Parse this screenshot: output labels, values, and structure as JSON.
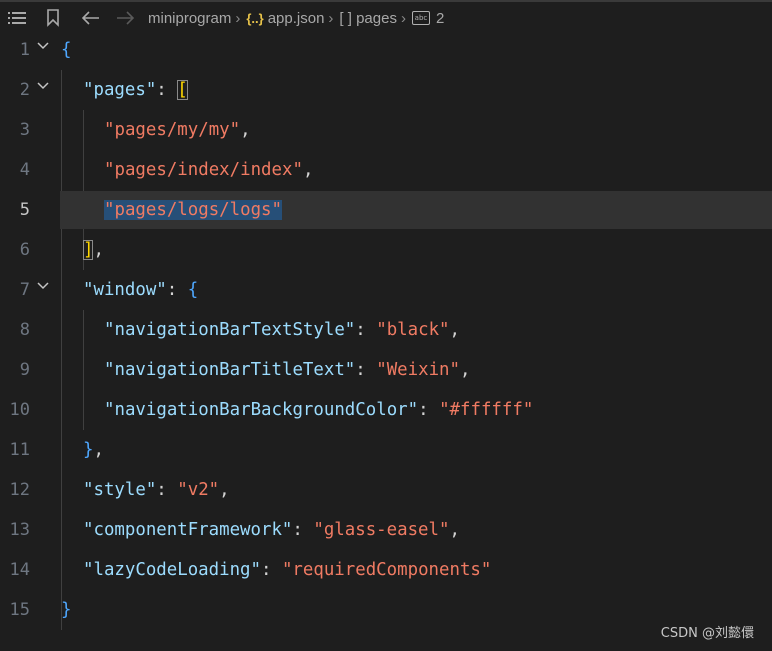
{
  "breadcrumb": {
    "items": [
      "miniprogram",
      "app.json",
      "[ ] pages",
      "2"
    ],
    "icons": [
      "list-icon",
      "bookmark-icon",
      "back-arrow-icon",
      "forward-arrow-icon"
    ]
  },
  "editor": {
    "current_line": 5,
    "line_numbers": [
      "1",
      "2",
      "3",
      "4",
      "5",
      "6",
      "7",
      "8",
      "9",
      "10",
      "11",
      "12",
      "13",
      "14",
      "15"
    ]
  },
  "code": {
    "l1_brace": "{",
    "l2_key": "\"pages\"",
    "l2_colon": ": ",
    "l2_bracket": "[",
    "l3_val": "\"pages/my/my\"",
    "l3_comma": ",",
    "l4_val": "\"pages/index/index\"",
    "l4_comma": ",",
    "l5_val": "\"pages/logs/logs\"",
    "l6_bracket": "]",
    "l6_comma": ",",
    "l7_key": "\"window\"",
    "l7_colon": ": ",
    "l7_brace": "{",
    "l8_key": "\"navigationBarTextStyle\"",
    "l8_colon": ": ",
    "l8_val": "\"black\"",
    "l8_comma": ",",
    "l9_key": "\"navigationBarTitleText\"",
    "l9_colon": ": ",
    "l9_val": "\"Weixin\"",
    "l9_comma": ",",
    "l10_key": "\"navigationBarBackgroundColor\"",
    "l10_colon": ": ",
    "l10_val": "\"#ffffff\"",
    "l11_brace": "}",
    "l11_comma": ",",
    "l12_key": "\"style\"",
    "l12_colon": ": ",
    "l12_val": "\"v2\"",
    "l12_comma": ",",
    "l13_key": "\"componentFramework\"",
    "l13_colon": ": ",
    "l13_val": "\"glass-easel\"",
    "l13_comma": ",",
    "l14_key": "\"lazyCodeLoading\"",
    "l14_colon": ": ",
    "l14_val": "\"requiredComponents\"",
    "l15_brace": "}"
  },
  "colors": {
    "background": "#1e1e1e",
    "key": "#9cdcfe",
    "string": "#ce9178",
    "current_line": "#323232",
    "selection": "#264f78"
  },
  "watermark": "CSDN @刘懿儇"
}
